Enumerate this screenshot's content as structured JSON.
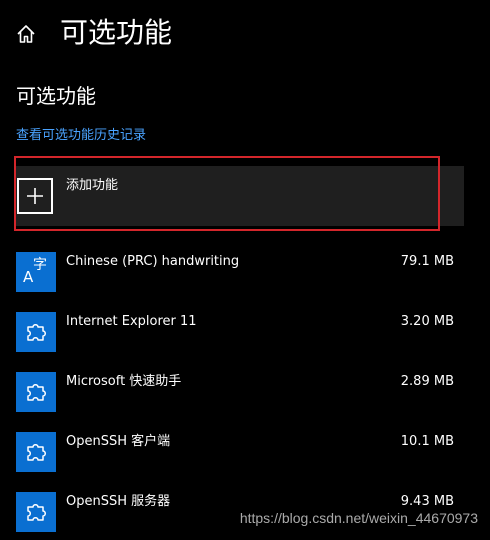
{
  "header": {
    "title": "可选功能",
    "home_icon": "home-icon"
  },
  "section": {
    "title": "可选功能",
    "history_link": "查看可选功能历史记录"
  },
  "add_feature": {
    "label": "添加功能",
    "icon": "plus-icon"
  },
  "colors": {
    "background": "#000000",
    "accent": "#0a6fd1",
    "link": "#4aa3ff",
    "highlight": "#d3262b",
    "panel": "#1f1f1f"
  },
  "features": [
    {
      "name": "Chinese (PRC) handwriting",
      "size": "79.1 MB",
      "icon": "language-icon"
    },
    {
      "name": "Internet Explorer 11",
      "size": "3.20 MB",
      "icon": "puzzle-icon"
    },
    {
      "name": "Microsoft 快速助手",
      "size": "2.89 MB",
      "icon": "puzzle-icon"
    },
    {
      "name": "OpenSSH 客户端",
      "size": "10.1 MB",
      "icon": "puzzle-icon"
    },
    {
      "name": "OpenSSH 服务器",
      "size": "9.43 MB",
      "icon": "puzzle-icon"
    }
  ],
  "watermark": "https://blog.csdn.net/weixin_44670973"
}
